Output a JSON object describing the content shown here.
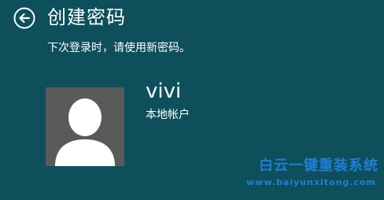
{
  "header": {
    "back_icon": "back-arrow-icon",
    "title": "创建密码"
  },
  "subtitle": "下次登录时，请使用新密码。",
  "user": {
    "name": "vivi",
    "account_type": "本地帐户",
    "avatar_icon": "default-user-avatar-icon"
  },
  "watermark": {
    "name": "白云一键重装系统",
    "url": "www.baiyunxitong.com"
  },
  "colors": {
    "background": "#0e4f5c",
    "text": "#ffffff",
    "avatar_background": "#5a5a5a",
    "watermark": "#1e7fd6"
  }
}
